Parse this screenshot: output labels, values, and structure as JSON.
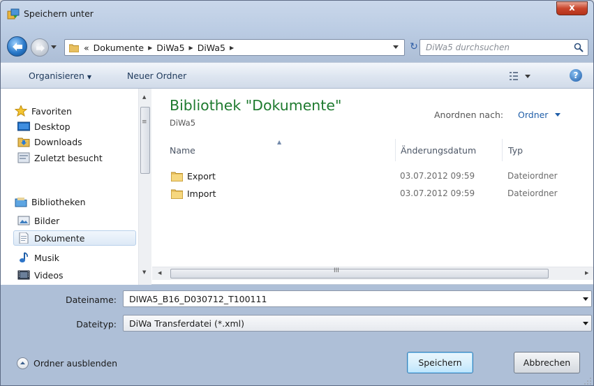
{
  "window": {
    "title": "Speichern unter",
    "close_label": "x"
  },
  "address": {
    "overflow": "«",
    "crumbs": [
      "Dokumente",
      "DiWa5",
      "DiWa5"
    ],
    "refresh_label": "↻",
    "search_placeholder": "DiWa5 durchsuchen"
  },
  "toolbar": {
    "organize_label": "Organisieren",
    "new_folder_label": "Neuer Ordner",
    "help_label": "?"
  },
  "navpane": {
    "favorites": [
      {
        "label": "Favoriten",
        "icon": "star-icon"
      },
      {
        "label": "Desktop",
        "icon": "desktop-icon"
      },
      {
        "label": "Downloads",
        "icon": "downloads-icon"
      },
      {
        "label": "Zuletzt besucht",
        "icon": "recent-places-icon"
      }
    ],
    "libraries": [
      {
        "label": "Bibliotheken",
        "icon": "libraries-icon"
      },
      {
        "label": "Bilder",
        "icon": "pictures-icon"
      },
      {
        "label": "Dokumente",
        "icon": "documents-icon",
        "selected": true
      },
      {
        "label": "Musik",
        "icon": "music-icon"
      },
      {
        "label": "Videos",
        "icon": "videos-icon"
      }
    ]
  },
  "library": {
    "title": "Bibliothek \"Dokumente\"",
    "subtitle": "DiWa5",
    "arrange_label": "Anordnen nach:",
    "arrange_value": "Ordner"
  },
  "columns": {
    "name": "Name",
    "date": "Änderungsdatum",
    "type": "Typ"
  },
  "files": [
    {
      "name": "Export",
      "date": "03.07.2012 09:59",
      "type": "Dateiordner"
    },
    {
      "name": "Import",
      "date": "03.07.2012 09:59",
      "type": "Dateiordner"
    }
  ],
  "form": {
    "filename_label": "Dateiname:",
    "filename_value": "DIWA5_B16_D030712_T100111",
    "filetype_label": "Dateityp:",
    "filetype_value": "DiWa Transferdatei (*.xml)"
  },
  "footer": {
    "hide_folders_label": "Ordner ausblenden",
    "save_label": "Speichern",
    "cancel_label": "Abbrechen"
  },
  "colors": {
    "library_title": "#1e7a2e",
    "link_blue": "#1f5ea8",
    "close_red": "#c9462c"
  }
}
